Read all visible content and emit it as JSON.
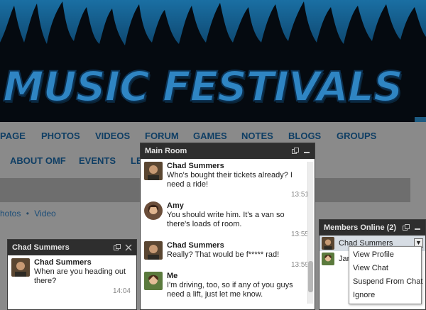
{
  "banner": {
    "title": "MUSIC FESTIVALS"
  },
  "nav_primary": [
    "PAGE",
    "PHOTOS",
    "VIDEOS",
    "FORUM",
    "GAMES",
    "NOTES",
    "BLOGS",
    "GROUPS"
  ],
  "nav_secondary": [
    "ABOUT OMF",
    "EVENTS",
    "LE"
  ],
  "breadcrumb": {
    "item1": "hotos",
    "separator": "•",
    "item2": "Video"
  },
  "small_chat": {
    "title": "Chad Summers",
    "message": {
      "name": "Chad Summers",
      "text": "When are you heading out there?",
      "time": "14:04"
    }
  },
  "main_room": {
    "title": "Main Room",
    "messages": [
      {
        "name": "Chad Summers",
        "text": "Who's bought their tickets already? I need a ride!",
        "time": "13:51"
      },
      {
        "name": "Amy",
        "text": "You should write him. It's a van so there's loads of room.",
        "time": "13:55"
      },
      {
        "name": "Chad Summers",
        "text": "Really? That would be f***** rad!",
        "time": "13:59"
      },
      {
        "name": "Me",
        "text": "I'm driving, too, so if any of you guys need a lift, just let me know.",
        "time": ""
      }
    ]
  },
  "members": {
    "title": "Members Online (2)",
    "list": [
      "Chad Summers",
      "Jan"
    ],
    "dropdown_arrow": "▼"
  },
  "context_menu": [
    "View Profile",
    "View Chat",
    "Suspend From Chat",
    "Ignore"
  ],
  "colors": {
    "accent": "#2f85c3",
    "header": "#2e2e2e",
    "nav": "#0f3e64"
  }
}
